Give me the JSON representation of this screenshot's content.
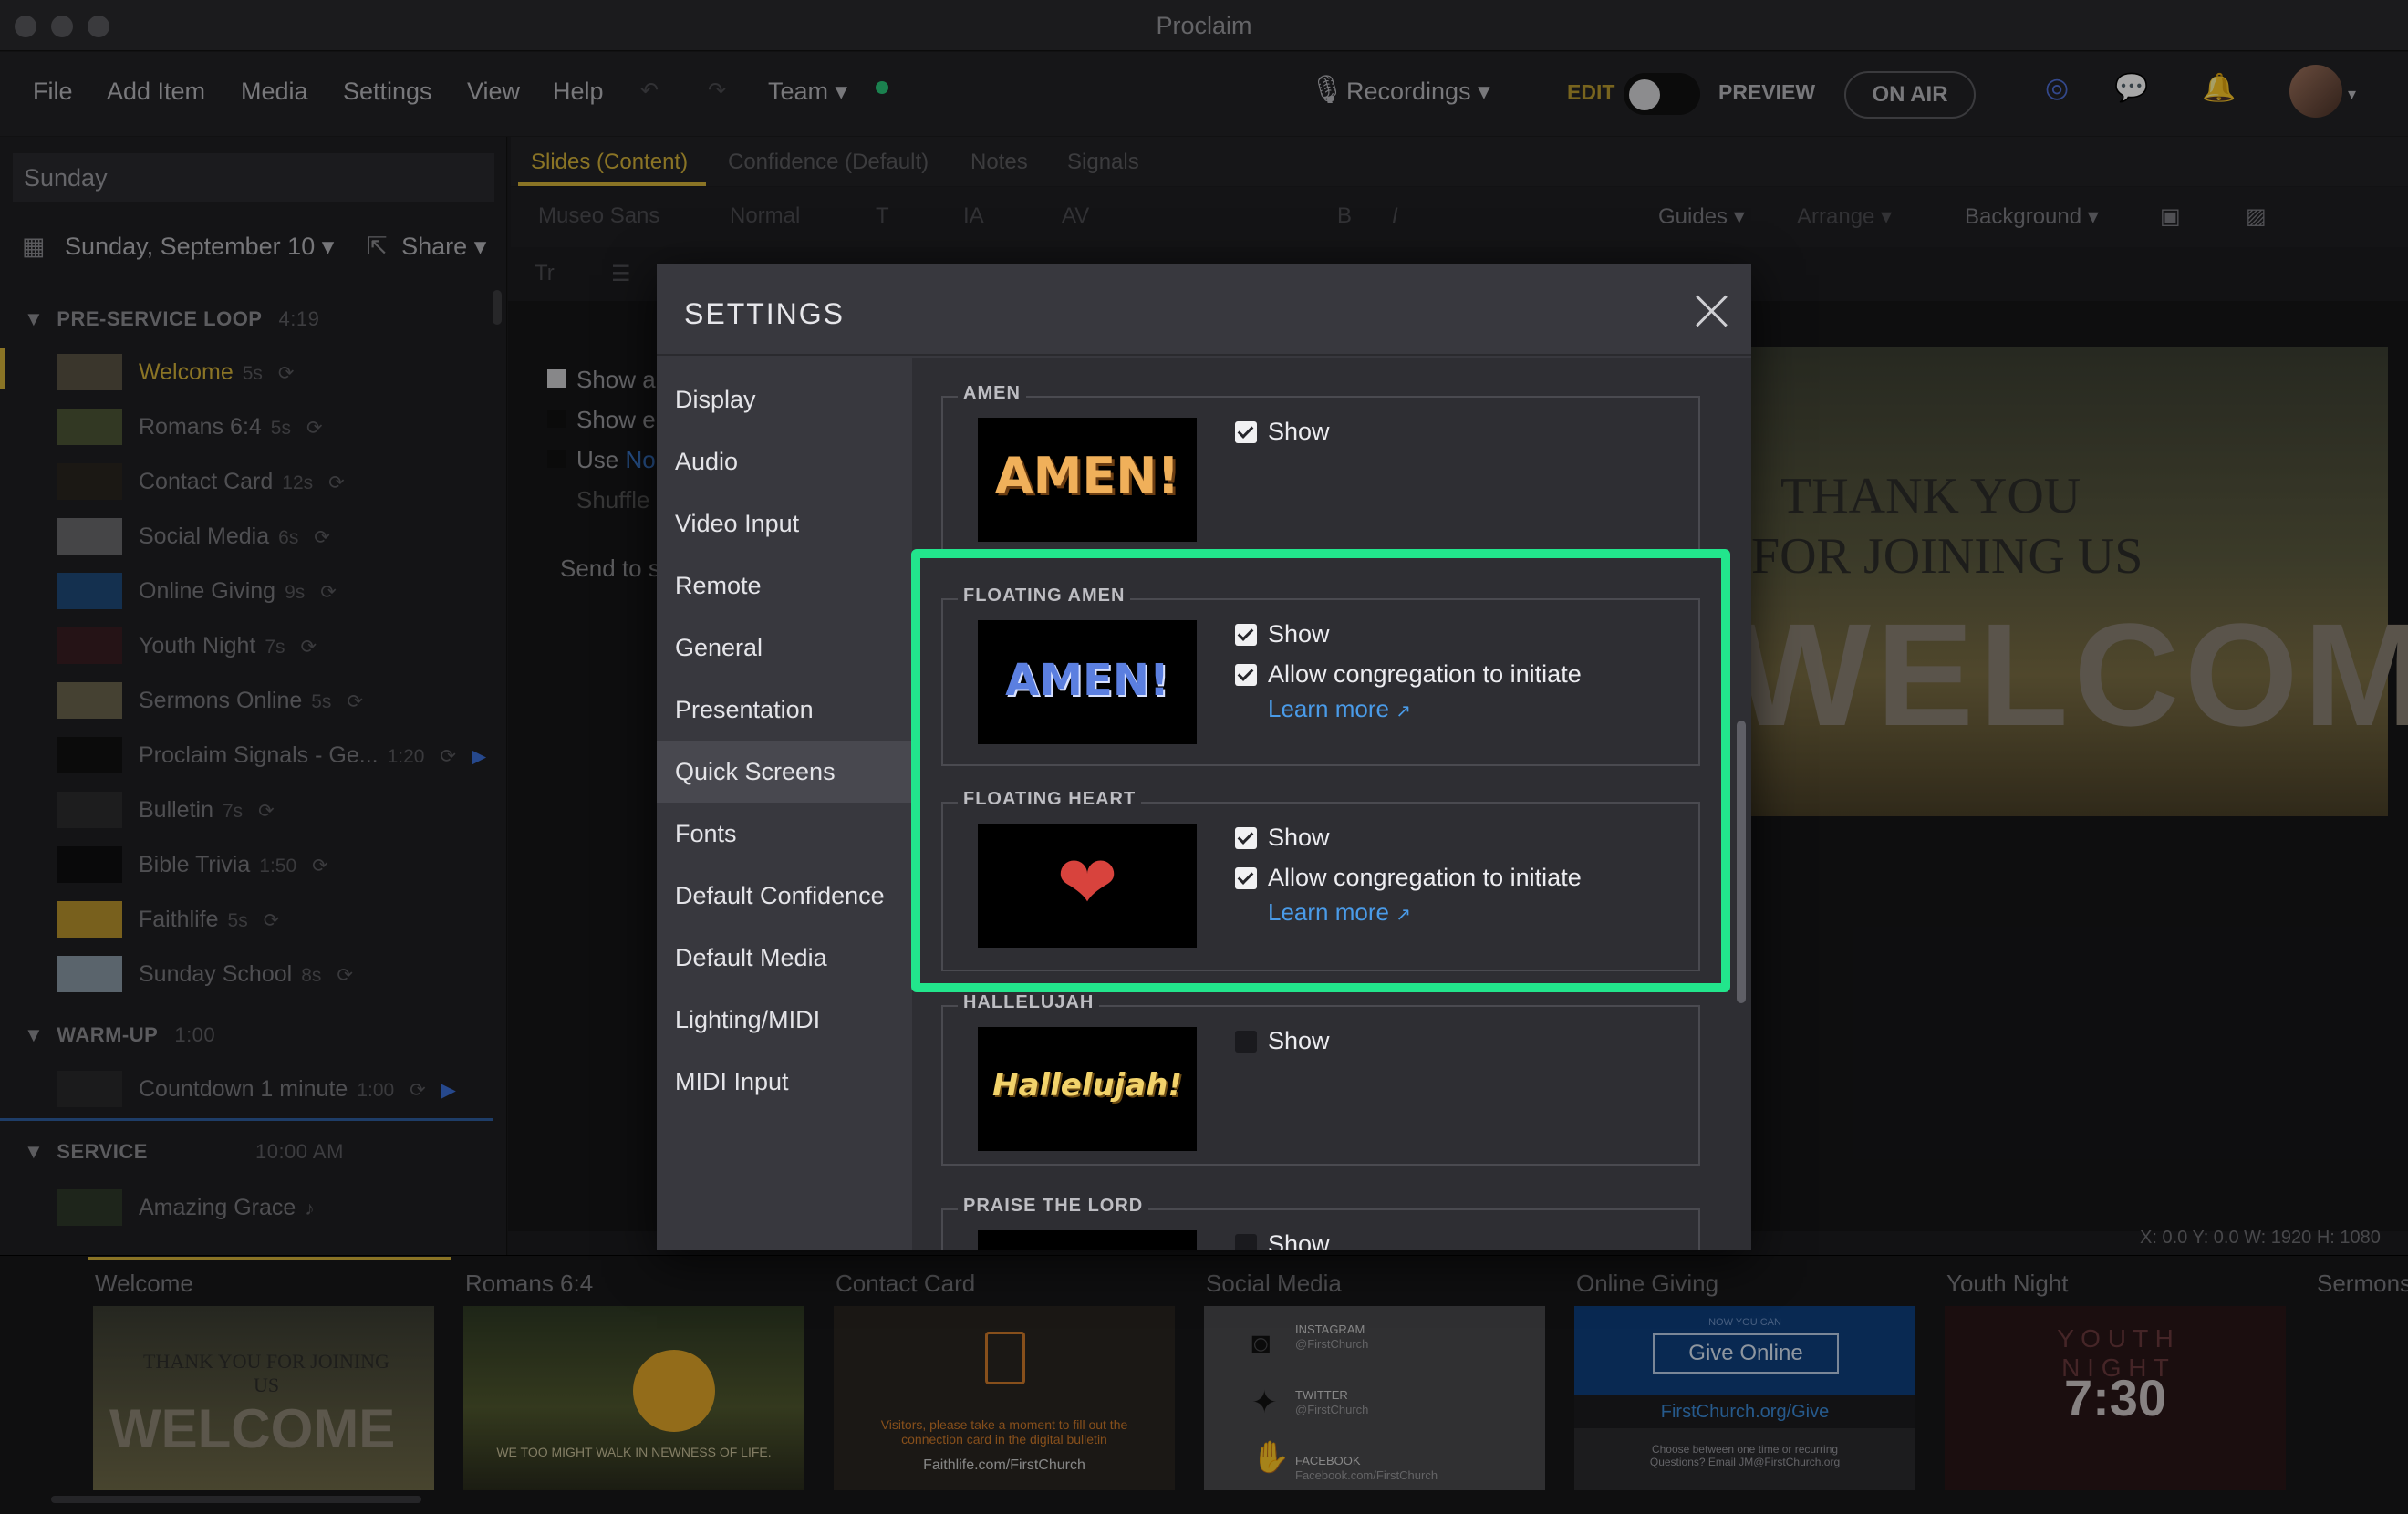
{
  "window": {
    "title": "Proclaim"
  },
  "menu": {
    "file": "File",
    "add_item": "Add Item",
    "media": "Media",
    "settings": "Settings",
    "view": "View",
    "help": "Help",
    "team": "Team ▾"
  },
  "topbar": {
    "recordings": "Recordings ▾",
    "edit": "EDIT",
    "preview": "PREVIEW",
    "on_air": "ON AIR"
  },
  "left": {
    "search_value": "Sunday",
    "date": "Sunday, September 10 ▾",
    "share": "Share ▾",
    "sections": [
      {
        "name": "PRE-SERVICE LOOP",
        "duration": "4:19"
      },
      {
        "name": "WARM-UP",
        "duration": "1:00"
      },
      {
        "name": "SERVICE",
        "duration": "10:00 AM"
      }
    ],
    "items": [
      {
        "label": "Welcome",
        "dur": "5s"
      },
      {
        "label": "Romans 6:4",
        "dur": "5s"
      },
      {
        "label": "Contact Card",
        "dur": "12s"
      },
      {
        "label": "Social Media",
        "dur": "6s"
      },
      {
        "label": "Online Giving",
        "dur": "9s"
      },
      {
        "label": "Youth Night",
        "dur": "7s"
      },
      {
        "label": "Sermons Online",
        "dur": "5s"
      },
      {
        "label": "Proclaim Signals - Ge...",
        "dur": "1:20"
      },
      {
        "label": "Bulletin",
        "dur": "7s"
      },
      {
        "label": "Bible Trivia",
        "dur": "1:50"
      },
      {
        "label": "Faithlife",
        "dur": "5s"
      },
      {
        "label": "Sunday School",
        "dur": "8s"
      },
      {
        "label": "Countdown 1 minute",
        "dur": "1:00"
      },
      {
        "label": "Amazing Grace",
        "dur": "♪"
      }
    ]
  },
  "editor": {
    "tabs": [
      "Slides (Content)",
      "Confidence (Default)",
      "Notes",
      "Signals"
    ],
    "font": "Museo Sans",
    "weight": "Normal",
    "guides": "Guides ▾",
    "arrange": "Arrange ▾",
    "background": "Background ▾",
    "behind": {
      "show_a": "Show a",
      "show_e": "Show e",
      "use": "Use",
      "use_link": "No",
      "shuffle": "Shuffle",
      "send": "Send to s"
    },
    "preview": {
      "line1": "THANK YOU",
      "line2": "FOR JOINING US",
      "line3": "WELCOME"
    },
    "coords": "X: 0.0  Y: 0.0    W: 1920  H: 1080"
  },
  "strip": [
    {
      "label": "Welcome",
      "text": "THANK YOU FOR JOINING US",
      "big": "WELCOME"
    },
    {
      "label": "Romans 6:4",
      "text": "WE TOO MIGHT WALK IN NEWNESS OF LIFE."
    },
    {
      "label": "Contact Card",
      "text": "Visitors, please take a moment to fill out the connection card in the digital bulletin",
      "url": "Faithlife.com/FirstChurch"
    },
    {
      "label": "Social Media",
      "lines": [
        "INSTAGRAM",
        "@FirstChurch",
        "TWITTER",
        "@FirstChurch",
        "FACEBOOK",
        "Facebook.com/FirstChurch"
      ]
    },
    {
      "label": "Online Giving",
      "kicker": "NOW YOU CAN",
      "button": "Give Online",
      "url": "FirstChurch.org/Give",
      "note": "Choose between one time or recurring\nQuestions? Email JM@FirstChurch.org"
    },
    {
      "label": "Youth Night",
      "word1": "Y O U T H",
      "word2": "N I G H T",
      "time": "7:30"
    },
    {
      "label": "Sermons"
    }
  ],
  "dialog": {
    "title": "SETTINGS",
    "sidebar": [
      "Display",
      "Audio",
      "Video Input",
      "Remote",
      "General",
      "Presentation",
      "Quick Screens",
      "Fonts",
      "Default Confidence",
      "Default Media",
      "Lighting/MIDI",
      "MIDI Input"
    ],
    "active": "Quick Screens",
    "groups": [
      {
        "title": "AMEN",
        "thumb_text": "AMEN!",
        "show": "Show"
      },
      {
        "title": "FLOATING AMEN",
        "thumb_text": "AMEN!",
        "show": "Show",
        "allow": "Allow congregation to initiate",
        "learn": "Learn more"
      },
      {
        "title": "FLOATING HEART",
        "thumb_text": "❤",
        "show": "Show",
        "allow": "Allow congregation to initiate",
        "learn": "Learn more"
      },
      {
        "title": "HALLELUJAH",
        "thumb_text": "Hallelujah!",
        "show": "Show"
      },
      {
        "title": "PRAISE THE LORD",
        "show": "Show"
      }
    ]
  },
  "colors": {
    "highlight": "#22e58c",
    "accent": "#d4b33a",
    "link": "#4a9be8"
  }
}
